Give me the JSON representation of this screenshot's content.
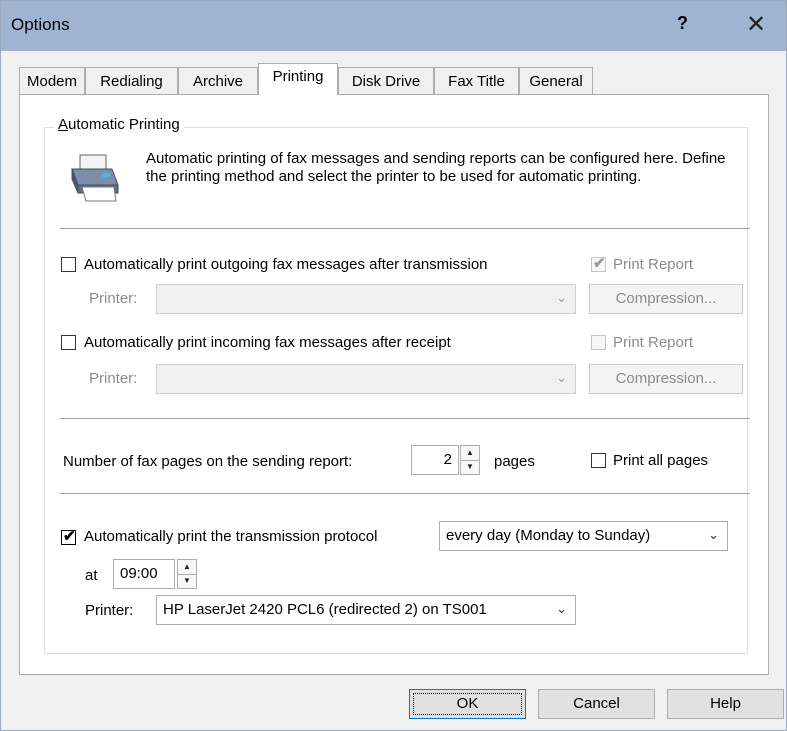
{
  "window": {
    "title": "Options",
    "help_glyph": "?",
    "close_glyph": "✕"
  },
  "tabs": [
    {
      "label": "Modem"
    },
    {
      "label": "Redialing"
    },
    {
      "label": "Archive"
    },
    {
      "label": "Printing"
    },
    {
      "label": "Disk Drive"
    },
    {
      "label": "Fax Title"
    },
    {
      "label": "General"
    }
  ],
  "active_tab": "Printing",
  "group": {
    "title_accel": "A",
    "title_rest": "utomatic Printing",
    "description": "Automatic printing of fax messages and sending reports can be configured here. Define the printing method and select the printer to be used for automatic printing."
  },
  "outgoing": {
    "label": "Automatically print outgoing fax messages after transmission",
    "checked": false,
    "printer_label": "Printer:",
    "printer_value": "",
    "print_report_label": "Print Report",
    "print_report_checked": true,
    "compression_label": "Compression..."
  },
  "incoming": {
    "label": "Automatically print incoming fax messages after receipt",
    "checked": false,
    "printer_label": "Printer:",
    "printer_value": "",
    "print_report_label": "Print Report",
    "print_report_checked": false,
    "compression_label": "Compression..."
  },
  "report_pages": {
    "label": "Number of fax pages on the sending report:",
    "value": "2",
    "unit": "pages",
    "print_all_label": "Print all pages",
    "print_all_checked": false
  },
  "protocol": {
    "label": "Automatically print the transmission protocol",
    "checked": true,
    "schedule_value": "every day (Monday to Sunday)",
    "at_label": "at",
    "time_value": "09:00",
    "printer_label": "Printer:",
    "printer_value": "HP LaserJet 2420 PCL6 (redirected 2) on TS001"
  },
  "buttons": {
    "ok": "OK",
    "cancel": "Cancel",
    "help": "Help"
  },
  "glyphs": {
    "check": "✔",
    "chevron": "⌄",
    "spin_up": "▲",
    "spin_down": "▼"
  }
}
